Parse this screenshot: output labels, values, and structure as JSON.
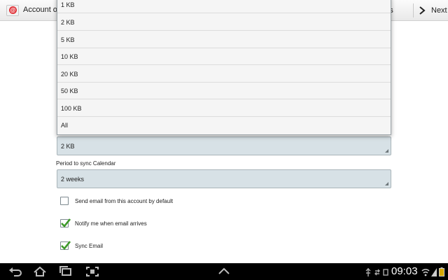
{
  "action_bar": {
    "title": "Account op",
    "previous_label": "evious",
    "next_label": "Next"
  },
  "form": {
    "size_spinner_value": "2 KB",
    "period_label": "Period to sync Calendar",
    "period_value": "2 weeks",
    "checkboxes": [
      {
        "label": "Send email from this account by default",
        "checked": false
      },
      {
        "label": "Notify me when email arrives",
        "checked": true
      },
      {
        "label": "Sync Email",
        "checked": true
      }
    ]
  },
  "dropdown": {
    "options": [
      "1 KB",
      "2 KB",
      "5 KB",
      "10 KB",
      "20 KB",
      "50 KB",
      "100 KB",
      "All"
    ]
  },
  "system_bar": {
    "time": "09:03"
  },
  "colors": {
    "spinner_bg": "#d7e1e6",
    "check_green": "#3f9a2b",
    "system_bar": "#000000"
  }
}
